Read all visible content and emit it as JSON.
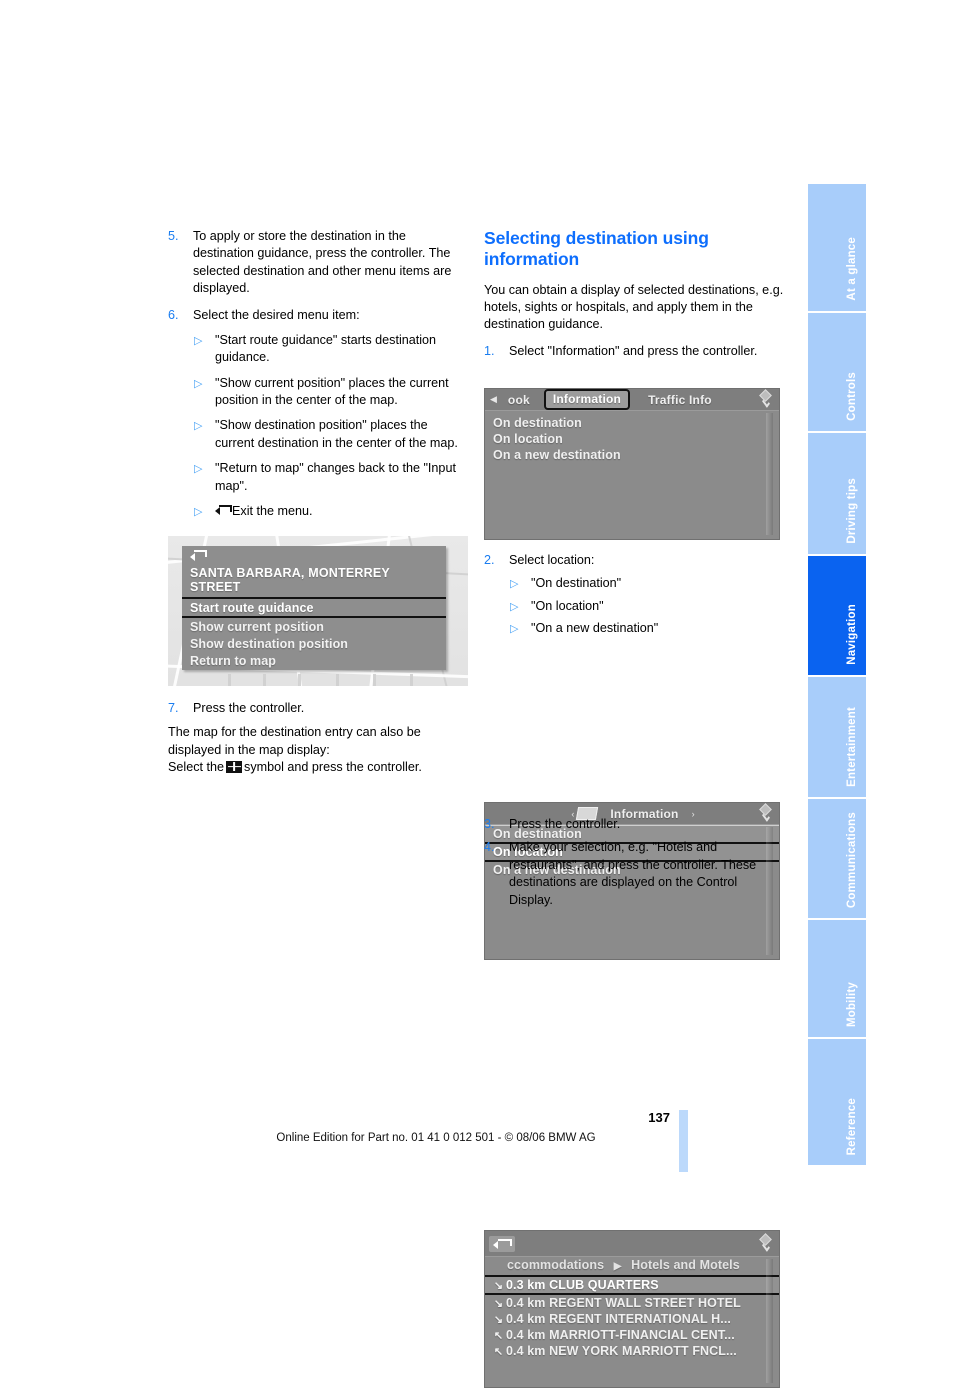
{
  "page": {
    "number": "137",
    "footer_text": "Online Edition for Part no. 01 41 0 012 501 - © 08/06 BMW AG",
    "accent_blue": "#0d6efd",
    "tab_blue": "#a8cdfa",
    "tab_active_blue": "#0a63f0"
  },
  "left_column": {
    "steps": [
      {
        "num": "5.",
        "text": "To apply or store the destination in the destination guidance, press the controller. The selected destination and other menu items are displayed."
      },
      {
        "num": "6.",
        "text": "Select the desired menu item:"
      }
    ],
    "bullets": [
      "\"Start route guidance\" starts destination guidance.",
      "\"Show current position\" places the current position in the center of the map.",
      "\"Show destination position\" places the current destination in the center of the map.",
      "\"Return to map\" changes back to the \"Input map\".",
      "Exit the menu."
    ],
    "step7": {
      "num": "7.",
      "text": "Press the controller."
    },
    "closing_line1": "The map for the destination entry can also be",
    "closing_line2": "displayed in the map display:",
    "closing_line3a": "Select the",
    "closing_line3b": "symbol and press the controller."
  },
  "right_column": {
    "heading": "Selecting destination using information",
    "intro": "You can obtain a display of selected destinations, e.g. hotels, sights or hospitals, and apply them in the destination guidance.",
    "step1": {
      "num": "1.",
      "text": "Select \"Information\" and press the controller."
    },
    "step2": {
      "num": "2.",
      "text": "Select location:"
    },
    "step2_bullets": [
      "\"On destination\"",
      "\"On location\"",
      "\"On a new destination\""
    ],
    "step3": {
      "num": "3.",
      "text": "Press the controller."
    },
    "step4": {
      "num": "4.",
      "text": "Make your selection, e.g. \"Hotels and restaurants\", and press the controller. These destinations are displayed on the Control Display."
    }
  },
  "figures": {
    "map_menu": {
      "back_icon": "back-arrow-icon",
      "address": "SANTA BARBARA, MONTERREY STREET",
      "items": [
        {
          "label": "Start route guidance",
          "selected": true
        },
        {
          "label": "Show current position",
          "selected": false
        },
        {
          "label": "Show destination position",
          "selected": false
        },
        {
          "label": "Return to map",
          "selected": false
        }
      ]
    },
    "information_screen": {
      "tabs": [
        {
          "label": "ook",
          "active": false
        },
        {
          "label": "Information",
          "active": true
        },
        {
          "label": "Traffic Info",
          "active": false
        }
      ],
      "items": [
        {
          "label": "On destination",
          "selected": false
        },
        {
          "label": "On location",
          "selected": false
        },
        {
          "label": "On a new destination",
          "selected": false
        }
      ]
    },
    "information_selected_screen": {
      "title": "Information",
      "left_caret": "‹",
      "right_caret": "›",
      "items": [
        {
          "label": "On destination",
          "selected": false,
          "highlight": true
        },
        {
          "label": "On location",
          "selected": true
        },
        {
          "label": "On a new destination",
          "selected": false
        }
      ]
    },
    "hotels_screen": {
      "breadcrumb_left": "ccommodations",
      "breadcrumb_sep": "▶",
      "breadcrumb_right": "Hotels and Motels",
      "items": [
        {
          "arrow": "↘",
          "label": "0.3 km CLUB QUARTERS",
          "selected": true
        },
        {
          "arrow": "↘",
          "label": "0.4 km REGENT WALL STREET HOTEL",
          "selected": false
        },
        {
          "arrow": "↘",
          "label": "0.4 km REGENT INTERNATIONAL H...",
          "selected": false
        },
        {
          "arrow": "↖",
          "label": "0.4 km MARRIOTT-FINANCIAL CENT...",
          "selected": false
        },
        {
          "arrow": "↖",
          "label": "0.4 km NEW YORK MARRIOTT FNCL...",
          "selected": false
        }
      ]
    }
  },
  "tabstrip": {
    "items": [
      {
        "label": "At a glance",
        "active": false
      },
      {
        "label": "Controls",
        "active": false
      },
      {
        "label": "Driving tips",
        "active": false
      },
      {
        "label": "Navigation",
        "active": true
      },
      {
        "label": "Entertainment",
        "active": false
      },
      {
        "label": "Communications",
        "active": false
      },
      {
        "label": "Mobility",
        "active": false
      },
      {
        "label": "Reference",
        "active": false
      }
    ]
  }
}
